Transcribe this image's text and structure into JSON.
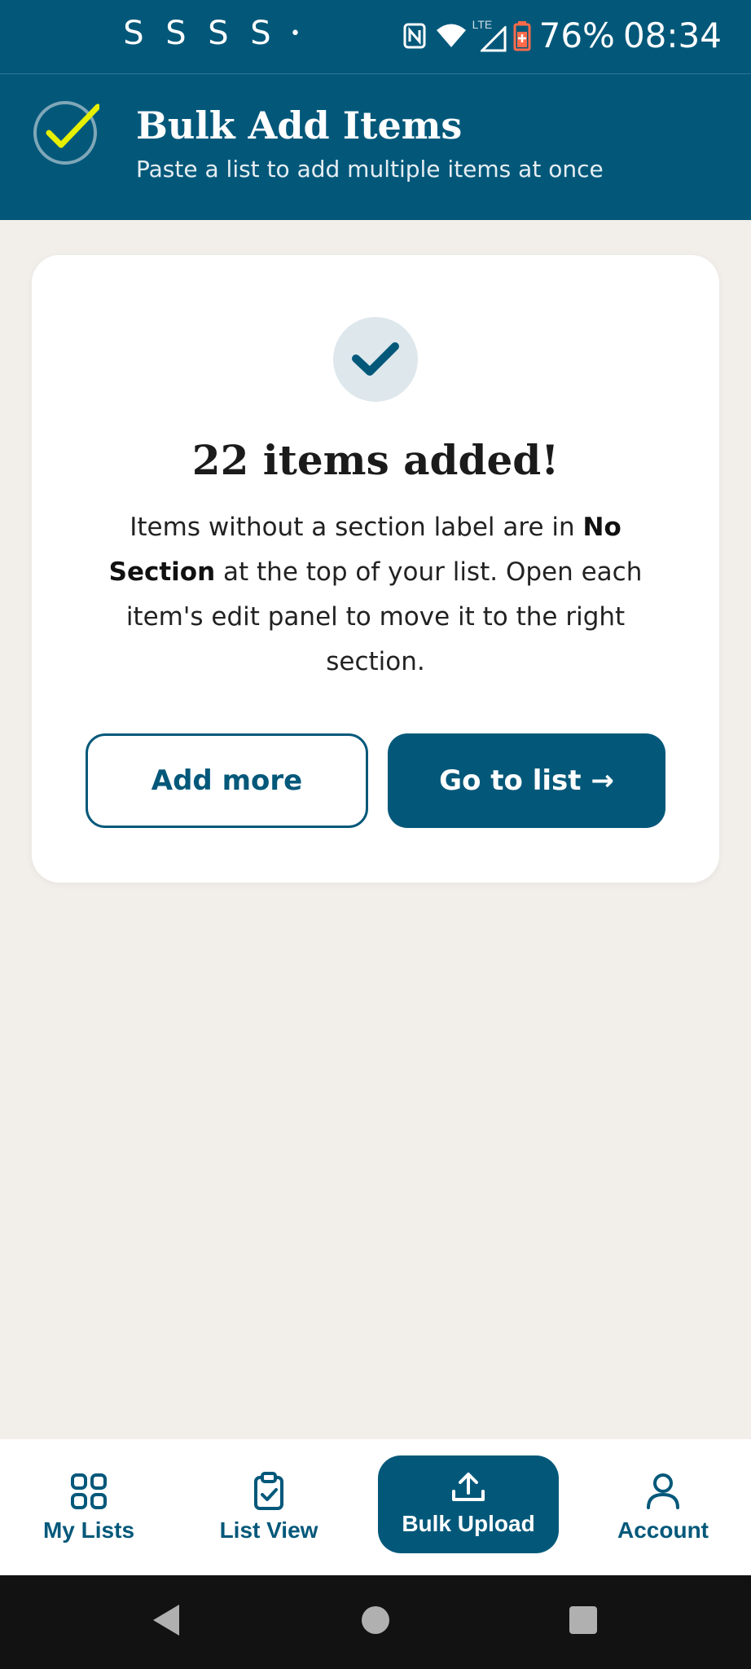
{
  "status_bar": {
    "left_glyphs": [
      "S",
      "S",
      "S",
      "S"
    ],
    "dot": "•",
    "network": "LTE",
    "battery": "76%",
    "time": "08:34"
  },
  "header": {
    "title": "Bulk Add Items",
    "subtitle": "Paste a list to add multiple items at once"
  },
  "success_card": {
    "title": "22 items added!",
    "body_part1": "Items without a section label are in ",
    "body_bold": "No Section",
    "body_part2": " at the top of your list. Open each item's edit panel to move it to the right section.",
    "add_more_label": "Add more",
    "go_to_list_label": "Go to list →"
  },
  "bottom_nav": {
    "items": [
      {
        "label": "My Lists",
        "icon": "grid-icon"
      },
      {
        "label": "List View",
        "icon": "clipboard-check-icon"
      },
      {
        "label": "Bulk Upload",
        "icon": "upload-icon"
      },
      {
        "label": "Account",
        "icon": "person-icon"
      }
    ],
    "active_index": 2
  },
  "colors": {
    "brand": "#03587a",
    "accent_check": "#e6f000",
    "background": "#f2efeb",
    "card": "#ffffff"
  }
}
